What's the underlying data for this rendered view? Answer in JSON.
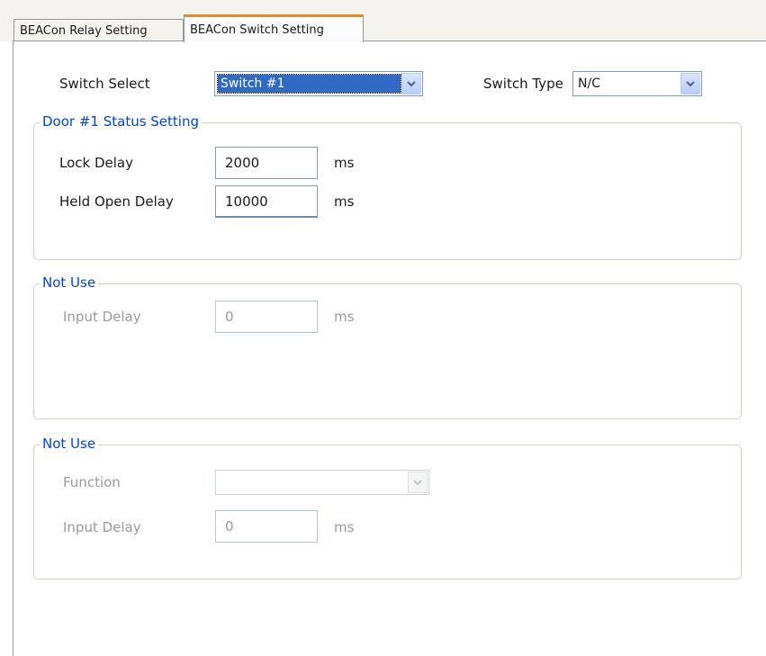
{
  "tabs": {
    "relay": "BEACon Relay Setting",
    "switch": "BEACon Switch Setting"
  },
  "top": {
    "switch_select_label": "Switch Select",
    "switch_select_value": "Switch #1",
    "switch_type_label": "Switch Type",
    "switch_type_value": "N/C"
  },
  "group1": {
    "title": "Door #1 Status Setting",
    "lock_delay_label": "Lock Delay",
    "lock_delay_value": "2000",
    "lock_delay_unit": "ms",
    "held_open_label": "Held Open Delay",
    "held_open_value": "10000",
    "held_open_unit": "ms"
  },
  "group2": {
    "title": "Not Use",
    "input_delay_label": "Input Delay",
    "input_delay_value": "0",
    "input_delay_unit": "ms"
  },
  "group3": {
    "title": "Not Use",
    "function_label": "Function",
    "function_value": "",
    "input_delay_label": "Input Delay",
    "input_delay_value": "0",
    "input_delay_unit": "ms"
  },
  "icons": {
    "dropdown": "chevron-down-icon"
  },
  "colors": {
    "tab_highlight": "#e68b2c",
    "group_title": "#0046d5",
    "selection": "#316ac5",
    "field_border": "#7f9db9"
  }
}
